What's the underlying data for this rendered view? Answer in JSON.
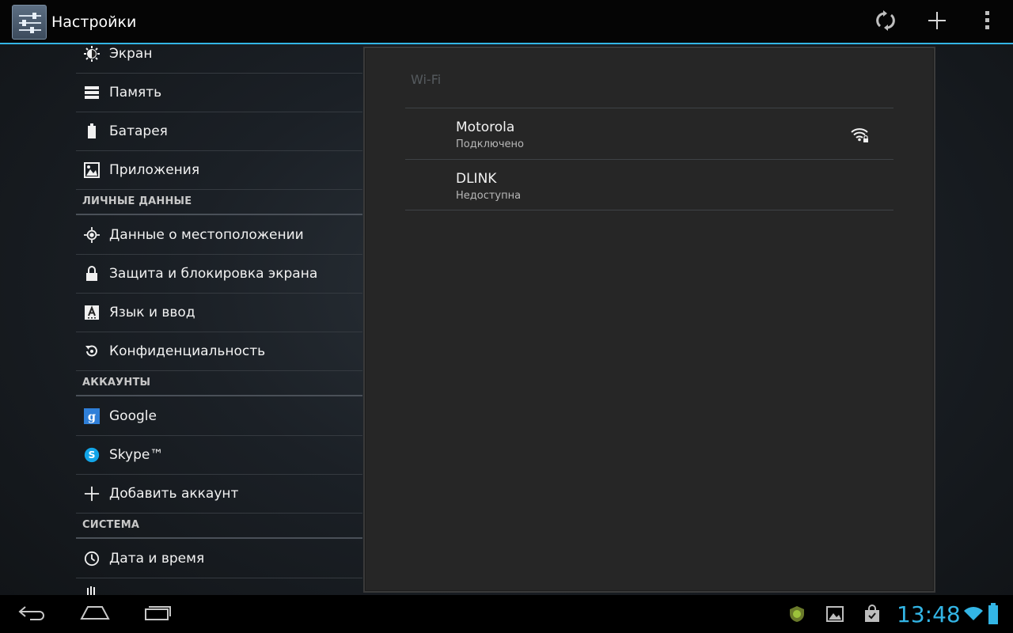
{
  "app": {
    "title": "Настройки",
    "icon": "settings-sliders-icon"
  },
  "action_bar": {
    "actions": [
      {
        "icon": "wifi-scan-icon",
        "name": "scan"
      },
      {
        "icon": "plus-icon",
        "name": "add-network"
      },
      {
        "icon": "overflow-menu-icon",
        "name": "more"
      }
    ]
  },
  "sidebar": {
    "items": [
      {
        "type": "item",
        "label": "Экран",
        "icon": "brightness-icon"
      },
      {
        "type": "item",
        "label": "Память",
        "icon": "storage-icon"
      },
      {
        "type": "item",
        "label": "Батарея",
        "icon": "battery-icon"
      },
      {
        "type": "item",
        "label": "Приложения",
        "icon": "apps-icon"
      },
      {
        "type": "section",
        "label": "ЛИЧНЫЕ ДАННЫЕ"
      },
      {
        "type": "item",
        "label": "Данные о местоположении",
        "icon": "location-icon"
      },
      {
        "type": "item",
        "label": "Защита и блокировка экрана",
        "icon": "lock-icon"
      },
      {
        "type": "item",
        "label": "Язык и ввод",
        "icon": "keyboard-a-icon"
      },
      {
        "type": "item",
        "label": "Конфиденциальность",
        "icon": "backup-icon"
      },
      {
        "type": "section",
        "label": "АККАУНТЫ"
      },
      {
        "type": "item",
        "label": "Google",
        "icon": "google-icon"
      },
      {
        "type": "item",
        "label": "Skype™",
        "icon": "skype-icon"
      },
      {
        "type": "item",
        "label": "Добавить аккаунт",
        "icon": "plus-icon"
      },
      {
        "type": "section",
        "label": "СИСТЕМА"
      },
      {
        "type": "item",
        "label": "Дата и время",
        "icon": "clock-icon"
      }
    ]
  },
  "wifi_panel": {
    "title": "Wi-Fi",
    "networks": [
      {
        "name": "Motorola",
        "status": "Подключено",
        "signal_icon": "wifi-locked-icon"
      },
      {
        "name": "DLINK",
        "status": "Недоступна"
      }
    ]
  },
  "status_bar": {
    "time": "13:48",
    "tray_icons": [
      "android-shield-icon",
      "gallery-icon",
      "shopping-bag-icon",
      "wifi-icon",
      "battery-icon"
    ]
  },
  "colors": {
    "accent": "#33b5e5",
    "panel_bg": "#262626",
    "action_bar_bg": "#050505"
  }
}
